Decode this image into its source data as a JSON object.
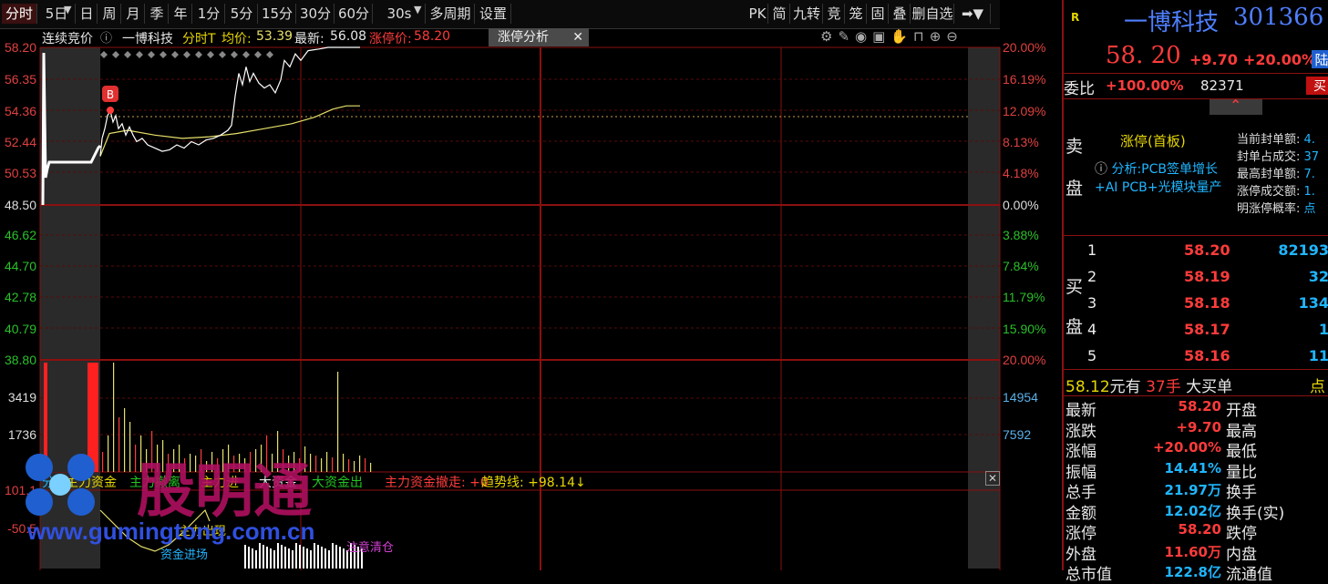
{
  "toolbar": {
    "periods": [
      "分时",
      "5日",
      "日",
      "周",
      "月",
      "季",
      "年",
      "1分",
      "5分",
      "15分",
      "30分",
      "60分",
      "30s",
      "多周期",
      "设置"
    ],
    "right_tools": [
      "PK",
      "简",
      "九转",
      "竞",
      "笼",
      "固",
      "叠",
      "删自选"
    ]
  },
  "infobar": {
    "auction_label": "连续竞价",
    "stock_name": "一博科技",
    "mode": "分时T",
    "avg_label": "均价:",
    "avg_value": "53.39",
    "latest_label": "最新:",
    "latest_value": "56.08",
    "limit_label": "涨停价:",
    "limit_value": "58.20",
    "tab_label": "涨停分析"
  },
  "price_axis": {
    "left": [
      "58.20",
      "56.35",
      "54.36",
      "52.44",
      "50.53",
      "48.50",
      "46.62",
      "44.70",
      "42.78",
      "40.79",
      "38.80"
    ],
    "right": [
      "20.00%",
      "16.19%",
      "12.09%",
      "8.13%",
      "4.18%",
      "0.00%",
      "3.88%",
      "7.84%",
      "11.79%",
      "15.90%",
      "20.00%"
    ]
  },
  "volume_axis": {
    "left": [
      "3419",
      "1736"
    ],
    "right": [
      "14954",
      "7592"
    ]
  },
  "indicator_axis": {
    "left": [
      "101.1",
      "-50.5"
    ]
  },
  "buy_marker": "B",
  "indicator_bar": {
    "items": [
      "分",
      "主力资金",
      "主力撤离",
      "主力进",
      "大资金",
      "大资金出",
      "主力资金撤走: +0"
    ],
    "trend_label": "趋势线: +98.14↓"
  },
  "indicator_labels": {
    "label1": "主力出现",
    "label2": "资金进场",
    "label3": "注意清仓"
  },
  "watermark": {
    "text": "股明通",
    "url": "www.gumingtong.com.cn"
  },
  "quote": {
    "flag": "R",
    "name": "一博科技",
    "code": "301366",
    "price": "58. 20",
    "change": "+9.70",
    "pct": "+20.00%",
    "badge": "陆",
    "weibi_label": "委比",
    "weibi_value": "+100.00%",
    "weibi_vol": "82371",
    "sell_btn": "买"
  },
  "limit_info": {
    "sell_label_1": "卖",
    "sell_label_2": "盘",
    "status": "涨停(首板)",
    "analysis": "分析:PCB签单增长+AI PCB+光模块量产",
    "stats": [
      "当前封单额: 4.",
      "封单占成交: 37",
      "最高封单额: 7.",
      "涨停成交额: 1.",
      "明涨停概率: 点"
    ]
  },
  "buy_book": {
    "label_1": "买",
    "label_2": "盘",
    "rows": [
      {
        "level": "1",
        "price": "58.20",
        "vol": "82193"
      },
      {
        "level": "2",
        "price": "58.19",
        "vol": "32"
      },
      {
        "level": "3",
        "price": "58.18",
        "vol": "134"
      },
      {
        "level": "4",
        "price": "58.17",
        "vol": "1"
      },
      {
        "level": "5",
        "price": "58.16",
        "vol": "11"
      }
    ]
  },
  "big_order": {
    "price": "58.12",
    "text1": "元有",
    "qty": "37手",
    "text2": "大买单",
    "tail": "点"
  },
  "stats": [
    {
      "label": "最新",
      "value": "58.20",
      "label2": "开盘"
    },
    {
      "label": "涨跌",
      "value": "+9.70",
      "label2": "最高"
    },
    {
      "label": "涨幅",
      "value": "+20.00%",
      "label2": "最低"
    },
    {
      "label": "振幅",
      "value": "14.41%",
      "label2": "量比"
    },
    {
      "label": "总手",
      "value": "21.97万",
      "label2": "换手"
    },
    {
      "label": "金额",
      "value": "12.02亿",
      "label2": "换手(实)"
    },
    {
      "label": "涨停",
      "value": "58.20",
      "label2": "跌停"
    },
    {
      "label": "外盘",
      "value": "11.60万",
      "label2": "内盘"
    },
    {
      "label": "总市值",
      "value": "122.8亿",
      "label2": "流通值"
    }
  ],
  "colors": {
    "up": "#ff3b3b",
    "down": "#22c522",
    "grid": "#8b1010",
    "price_line": "#ffffff",
    "avg_line": "#e6e06a",
    "cyan": "#1fb6ff"
  }
}
